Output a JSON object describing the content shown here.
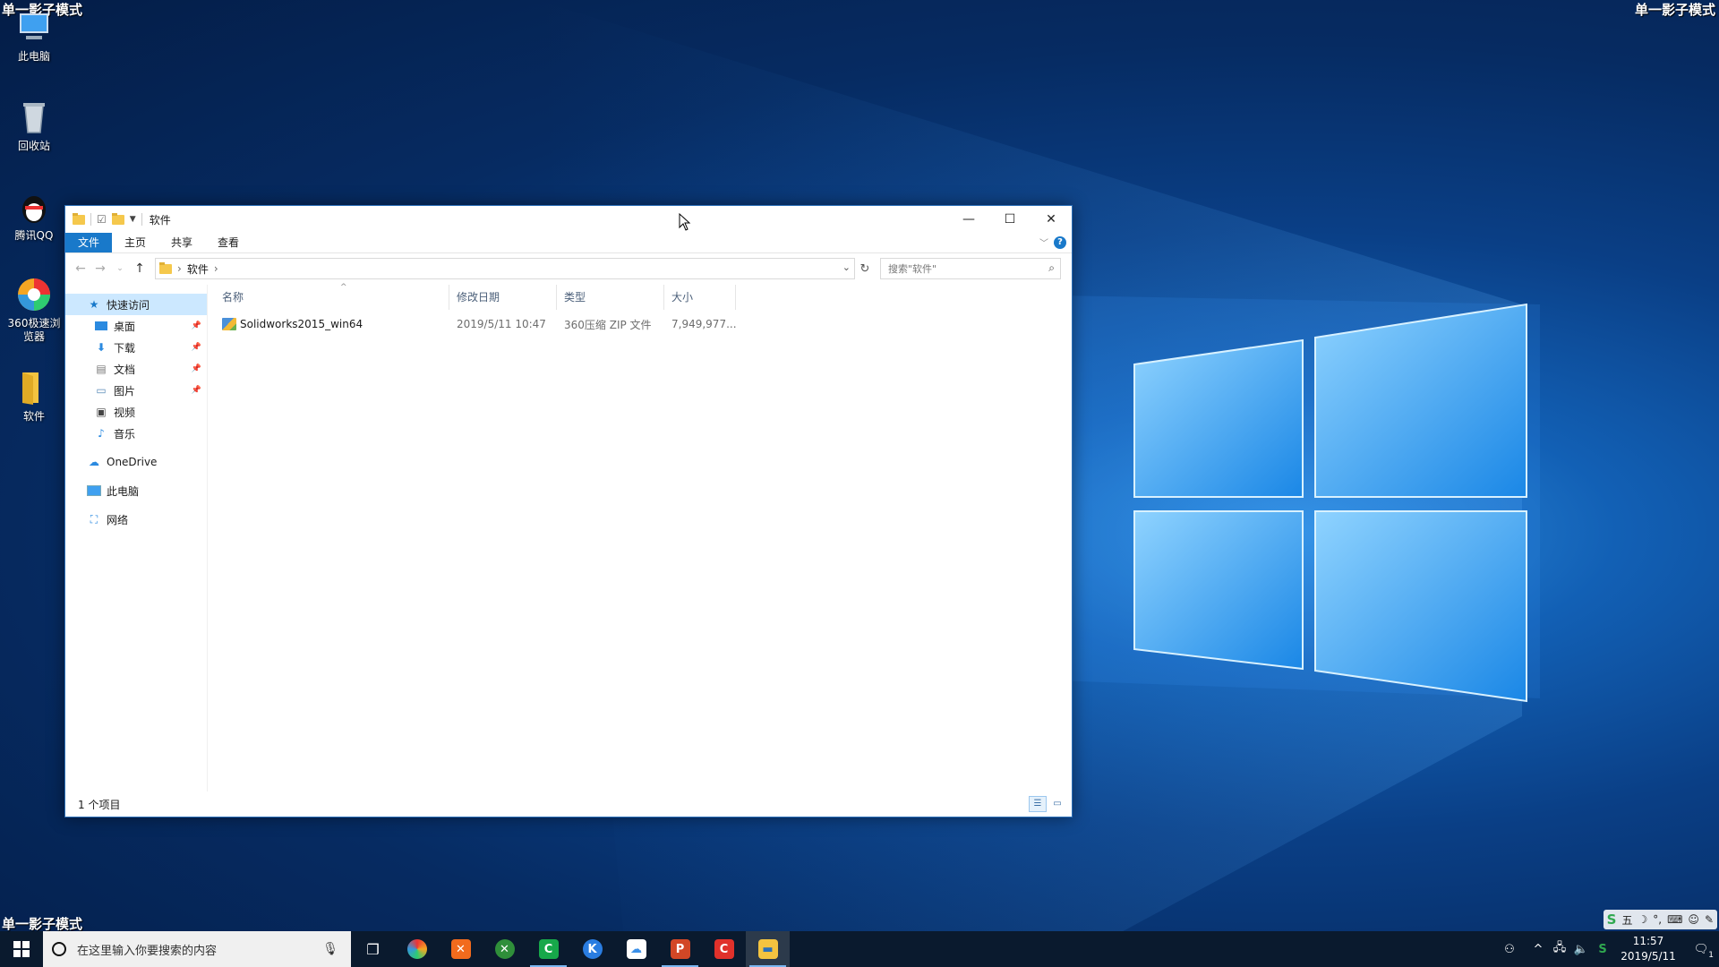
{
  "watermark": "单一影子模式",
  "desktop_icons": [
    {
      "label": "此电脑",
      "icon": "computer-icon"
    },
    {
      "label": "回收站",
      "icon": "recycle-bin-icon"
    },
    {
      "label": "腾讯QQ",
      "icon": "qq-icon"
    },
    {
      "label": "360极速浏览器",
      "icon": "browser-icon"
    },
    {
      "label": "软件",
      "icon": "folder-icon"
    }
  ],
  "window": {
    "title": "软件",
    "ribbon_tabs": [
      "文件",
      "主页",
      "共享",
      "查看"
    ],
    "address": {
      "crumb": "软件"
    },
    "search_placeholder": "搜索\"软件\"",
    "nav": {
      "quick_access": "快速访问",
      "quick_items": [
        {
          "label": "桌面",
          "pinned": true
        },
        {
          "label": "下载",
          "pinned": true
        },
        {
          "label": "文档",
          "pinned": true
        },
        {
          "label": "图片",
          "pinned": true
        },
        {
          "label": "视频",
          "pinned": false
        },
        {
          "label": "音乐",
          "pinned": false
        }
      ],
      "onedrive": "OneDrive",
      "this_pc": "此电脑",
      "network": "网络"
    },
    "columns": [
      "名称",
      "修改日期",
      "类型",
      "大小"
    ],
    "files": [
      {
        "name": "Solidworks2015_win64",
        "modified": "2019/5/11 10:47",
        "type": "360压缩 ZIP 文件",
        "size": "7,949,977..."
      }
    ],
    "status": "1 个项目"
  },
  "taskbar": {
    "search_placeholder": "在这里输入你要搜索的内容",
    "apps": [
      {
        "icon": "task-view-icon"
      },
      {
        "icon": "360-browser-icon",
        "color": "#e8532f"
      },
      {
        "icon": "tool-icon",
        "color": "#f26b1d"
      },
      {
        "icon": "xbox-icon",
        "color": "#2f8f3a"
      },
      {
        "icon": "camtasia-icon",
        "color": "#17a84a"
      },
      {
        "icon": "kugou-icon",
        "color": "#2a7de1"
      },
      {
        "icon": "baidu-netdisk-icon",
        "color": "#3a8fe8"
      },
      {
        "icon": "powerpoint-icon",
        "color": "#d24726"
      },
      {
        "icon": "c-app-icon",
        "color": "#e0312b"
      },
      {
        "icon": "file-explorer-icon",
        "color": "#f3c340"
      }
    ],
    "clock_time": "11:57",
    "clock_date": "2019/5/11",
    "notification_count": "1"
  },
  "ime": {
    "mode": "五"
  }
}
